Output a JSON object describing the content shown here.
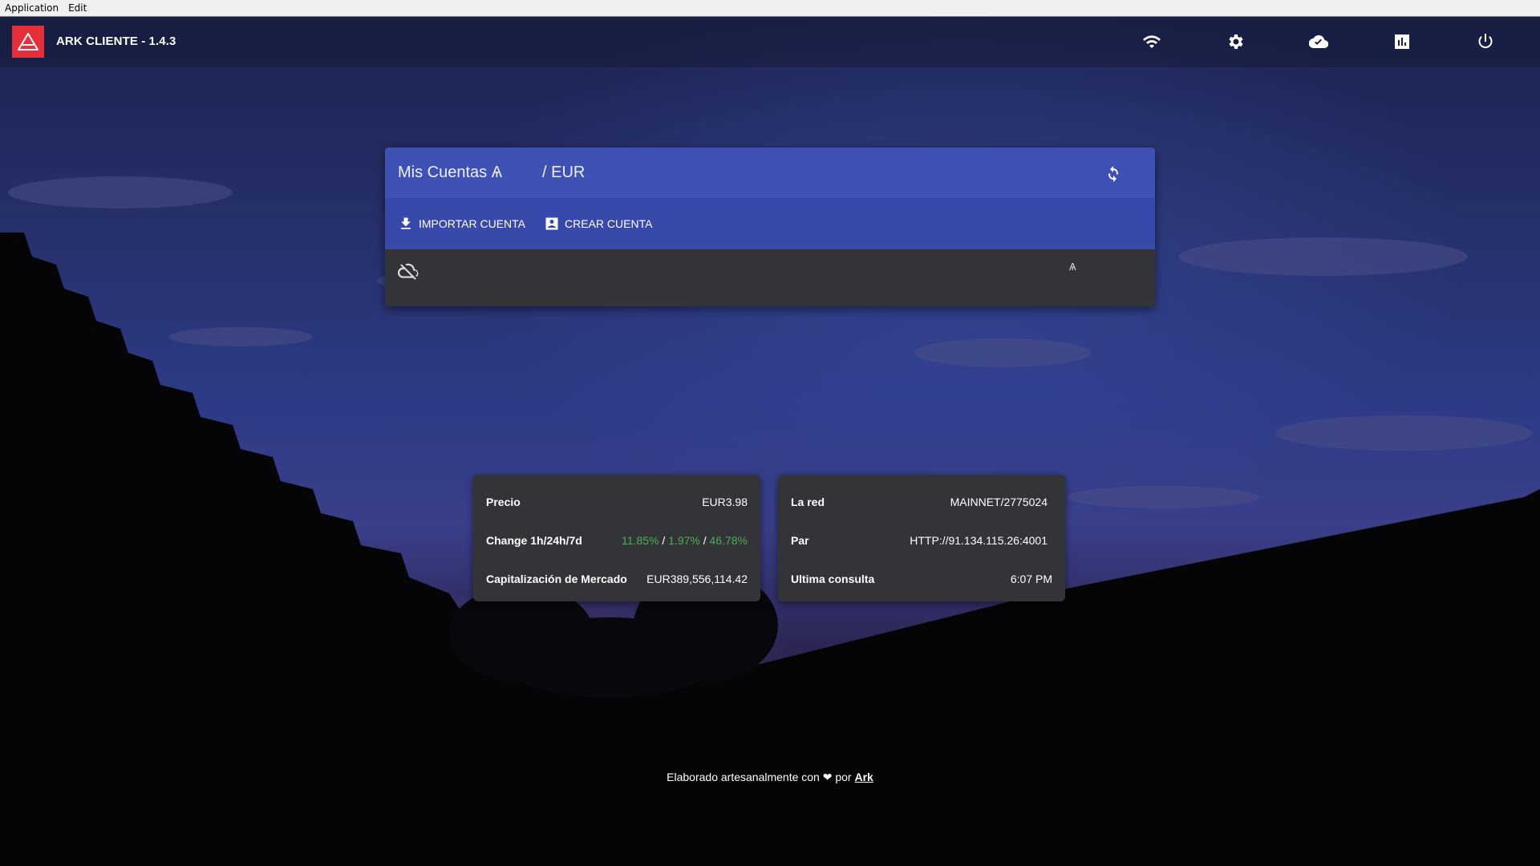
{
  "menubar": {
    "items": [
      "Application",
      "Edit"
    ]
  },
  "toolbar": {
    "title": "ARK CLIENTE - 1.4.3",
    "icons": [
      "wifi-icon",
      "settings-icon",
      "cloud-icon",
      "chart-icon",
      "power-icon"
    ]
  },
  "accounts": {
    "title": "Mis Cuentas Ѧ",
    "currency": "/ EUR",
    "import_label": "IMPORTAR CUENTA",
    "create_label": "CREAR CUENTA",
    "symbol": "Ѧ"
  },
  "market": {
    "price_label": "Precio",
    "price_value": "EUR3.98",
    "change_label": "Change 1h/24h/7d",
    "change_1h": "11.85%",
    "change_24h": "1.97%",
    "change_7d": "46.78%",
    "sep": "/",
    "cap_label": "Capitalización de Mercado",
    "cap_value": "EUR389,556,114.42"
  },
  "network": {
    "net_label": "La red",
    "net_value": "MAINNET/2775024",
    "peer_label": "Par",
    "peer_value": "HTTP://91.134.115.26:4001",
    "last_label": "Ultima consulta",
    "last_value": "6:07 PM"
  },
  "footer": {
    "text_before": "Elaborado artesanalmente con",
    "text_mid": "por",
    "link": "Ark"
  },
  "colors": {
    "accent": "#3f51b5",
    "accent_dark": "#3949ab",
    "brand_red": "#e52f3a",
    "positive": "#4caf50",
    "card": "#333438"
  }
}
